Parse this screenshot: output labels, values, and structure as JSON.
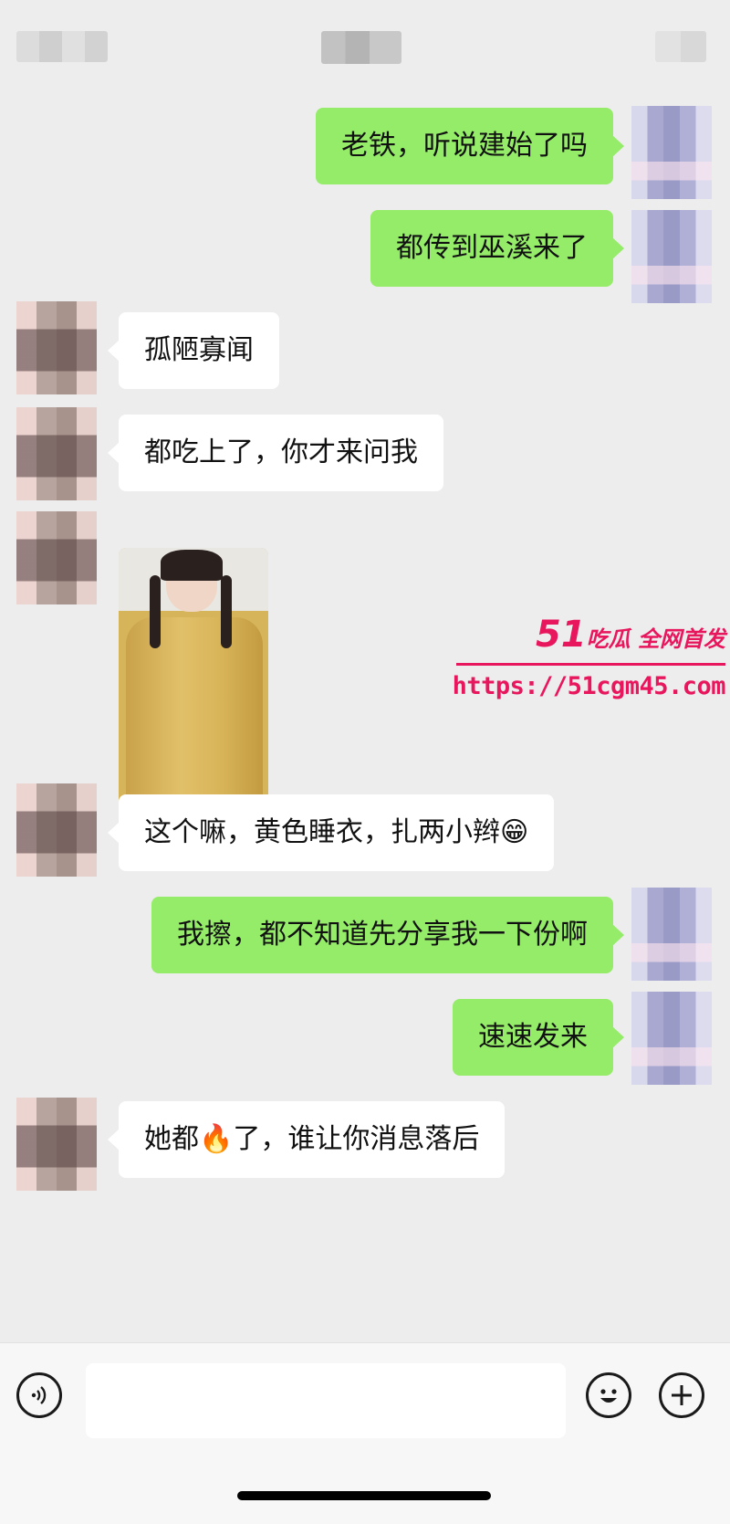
{
  "header": {
    "back_label_blurred": true,
    "title_blurred": true,
    "more_blurred": true
  },
  "messages": [
    {
      "side": "right",
      "type": "text",
      "text": "老铁，听说建始了吗"
    },
    {
      "side": "right",
      "type": "text",
      "text": "都传到巫溪来了"
    },
    {
      "side": "left",
      "type": "text",
      "text": "孤陋寡闻"
    },
    {
      "side": "left",
      "type": "text",
      "text": "都吃上了，你才来问我"
    },
    {
      "side": "left",
      "type": "image",
      "text": ""
    },
    {
      "side": "left",
      "type": "text",
      "text": "这个嘛，黄色睡衣，扎两小辫😁"
    },
    {
      "side": "right",
      "type": "text",
      "text": "我擦，都不知道先分享我一下份啊"
    },
    {
      "side": "right",
      "type": "text",
      "text": "速速发来"
    },
    {
      "side": "left",
      "type": "text",
      "text": "她都🔥了，谁让你消息落后"
    }
  ],
  "watermark": {
    "brand_number": "51",
    "brand_text": "吃瓜 全网首发",
    "url": "https://51cgm45.com",
    "color": "#e8175d"
  },
  "input_bar": {
    "voice_icon": "voice-icon",
    "emoji_icon": "emoji-icon",
    "plus_icon": "plus-icon",
    "input_value": ""
  },
  "colors": {
    "background": "#ededed",
    "bubble_self": "#95ec69",
    "bubble_other": "#ffffff"
  }
}
